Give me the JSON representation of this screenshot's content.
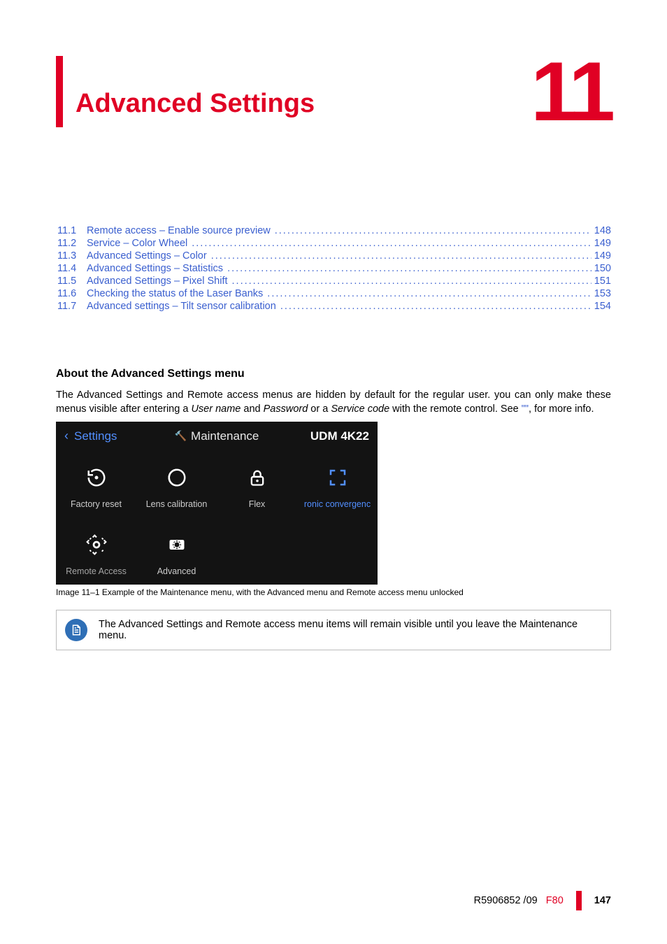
{
  "chapter": {
    "title": "Advanced Settings",
    "number": "11"
  },
  "toc": [
    {
      "num": "11.1",
      "title": "Remote access – Enable source preview",
      "page": "148"
    },
    {
      "num": "11.2",
      "title": "Service – Color Wheel",
      "page": "149"
    },
    {
      "num": "11.3",
      "title": "Advanced Settings – Color",
      "page": "149"
    },
    {
      "num": "11.4",
      "title": "Advanced Settings – Statistics",
      "page": "150"
    },
    {
      "num": "11.5",
      "title": "Advanced Settings – Pixel Shift",
      "page": "151"
    },
    {
      "num": "11.6",
      "title": "Checking the status of the Laser Banks",
      "page": "153"
    },
    {
      "num": "11.7",
      "title": "Advanced settings – Tilt sensor calibration",
      "page": "154"
    }
  ],
  "section": {
    "heading": "About the Advanced Settings menu",
    "para1_a": "The Advanced Settings and Remote access menus are hidden by default for the regular user. you can only make these menus visible after entering a ",
    "para1_user": "User name",
    "para1_b": " and ",
    "para1_pw": "Password",
    "para1_c": " or a ",
    "para1_sc": "Service code",
    "para1_d": " with the remote control. See ",
    "para1_link": "\"\"",
    "para1_e": ", for more info."
  },
  "maint": {
    "back": "Settings",
    "title": "Maintenance",
    "model": "UDM 4K22",
    "items": {
      "factory_reset": "Factory reset",
      "lens_calibration": "Lens calibration",
      "flex": "Flex",
      "convergence": "ronic convergenc",
      "remote_access": "Remote Access",
      "advanced": "Advanced"
    }
  },
  "caption": "Image 11–1   Example of the Maintenance menu, with the Advanced menu and Remote access menu unlocked",
  "note": "The Advanced Settings and Remote access menu items will remain visible until you leave the Maintenance menu.",
  "footer": {
    "docnum": "R5906852 /09",
    "model": "F80",
    "page": "147"
  }
}
